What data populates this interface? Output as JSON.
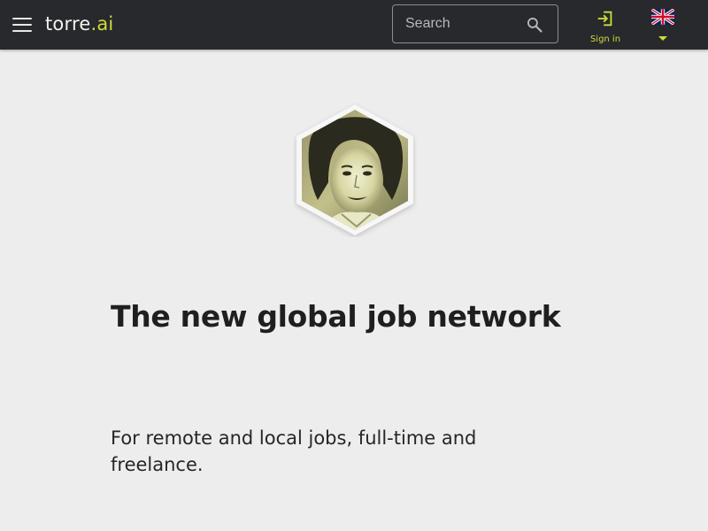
{
  "header": {
    "logo_main": "torre",
    "logo_dot": ".",
    "logo_suffix": "ai",
    "menu_icon": "hamburger-menu-icon",
    "search": {
      "placeholder": "Search",
      "value": "",
      "icon": "search-icon"
    },
    "signin": {
      "label": "Sign in",
      "icon": "sign-in-icon"
    },
    "language": {
      "icon": "uk-flag-icon",
      "caret_icon": "caret-down-icon"
    }
  },
  "hero": {
    "avatar_icon": "hexagon-portrait-avatar",
    "headline": "The new global job network",
    "subheadline": "For remote and local jobs, full-time and freelance."
  },
  "colors": {
    "topbar": "#27292d",
    "accent": "#cddc39",
    "background": "#ededed",
    "text_dark": "#1f1f1f"
  }
}
